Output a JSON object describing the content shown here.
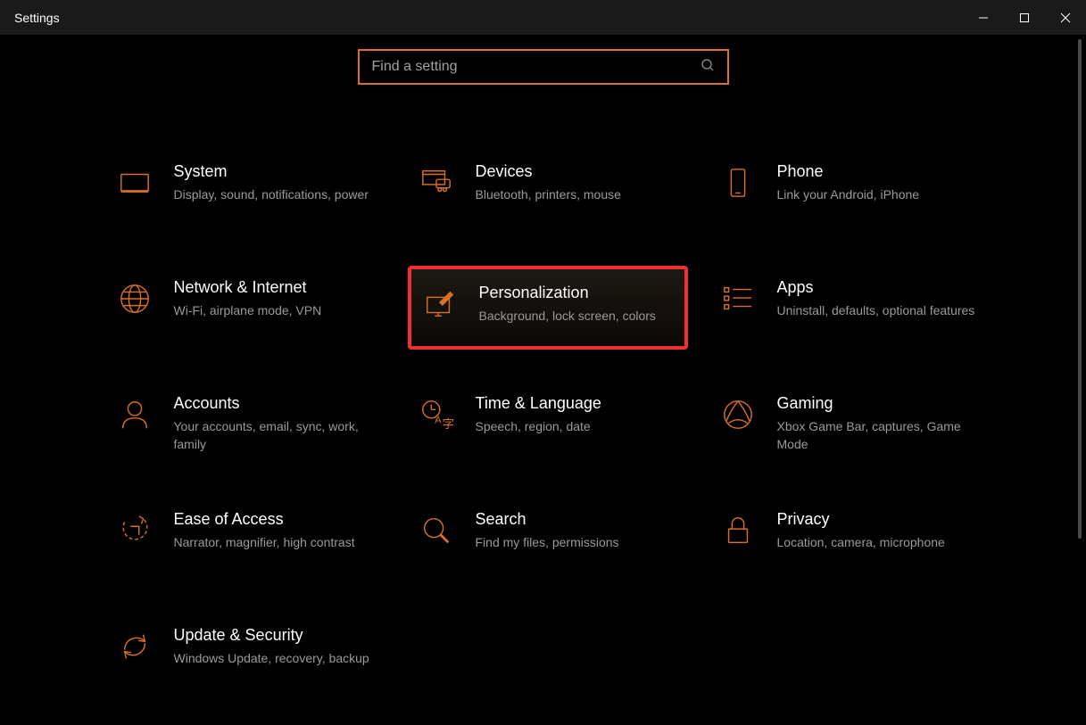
{
  "window": {
    "title": "Settings"
  },
  "search": {
    "placeholder": "Find a setting"
  },
  "tiles": {
    "system": {
      "title": "System",
      "desc": "Display, sound, notifications, power"
    },
    "devices": {
      "title": "Devices",
      "desc": "Bluetooth, printers, mouse"
    },
    "phone": {
      "title": "Phone",
      "desc": "Link your Android, iPhone"
    },
    "network": {
      "title": "Network & Internet",
      "desc": "Wi-Fi, airplane mode, VPN"
    },
    "personalization": {
      "title": "Personalization",
      "desc": "Background, lock screen, colors"
    },
    "apps": {
      "title": "Apps",
      "desc": "Uninstall, defaults, optional features"
    },
    "accounts": {
      "title": "Accounts",
      "desc": "Your accounts, email, sync, work, family"
    },
    "time": {
      "title": "Time & Language",
      "desc": "Speech, region, date"
    },
    "gaming": {
      "title": "Gaming",
      "desc": "Xbox Game Bar, captures, Game Mode"
    },
    "ease": {
      "title": "Ease of Access",
      "desc": "Narrator, magnifier, high contrast"
    },
    "search_tile": {
      "title": "Search",
      "desc": "Find my files, permissions"
    },
    "privacy": {
      "title": "Privacy",
      "desc": "Location, camera, microphone"
    },
    "update": {
      "title": "Update & Security",
      "desc": "Windows Update, recovery, backup"
    }
  },
  "highlighted_tile": "personalization",
  "colors": {
    "accent": "#d97026",
    "highlight_border": "#ef3030",
    "background": "#000000"
  }
}
